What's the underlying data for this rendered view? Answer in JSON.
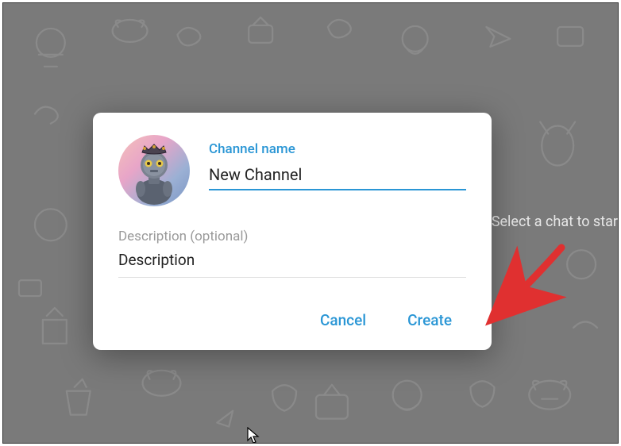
{
  "background": {
    "hint_text": "Select a chat to star"
  },
  "dialog": {
    "avatar_alt": "robot-avatar",
    "channel_name": {
      "label": "Channel name",
      "value": "New Channel"
    },
    "description": {
      "label": "Description (optional)",
      "value": "Description"
    },
    "buttons": {
      "cancel": "Cancel",
      "create": "Create"
    }
  },
  "colors": {
    "accent": "#2a96d5",
    "arrow": "#e03030"
  }
}
